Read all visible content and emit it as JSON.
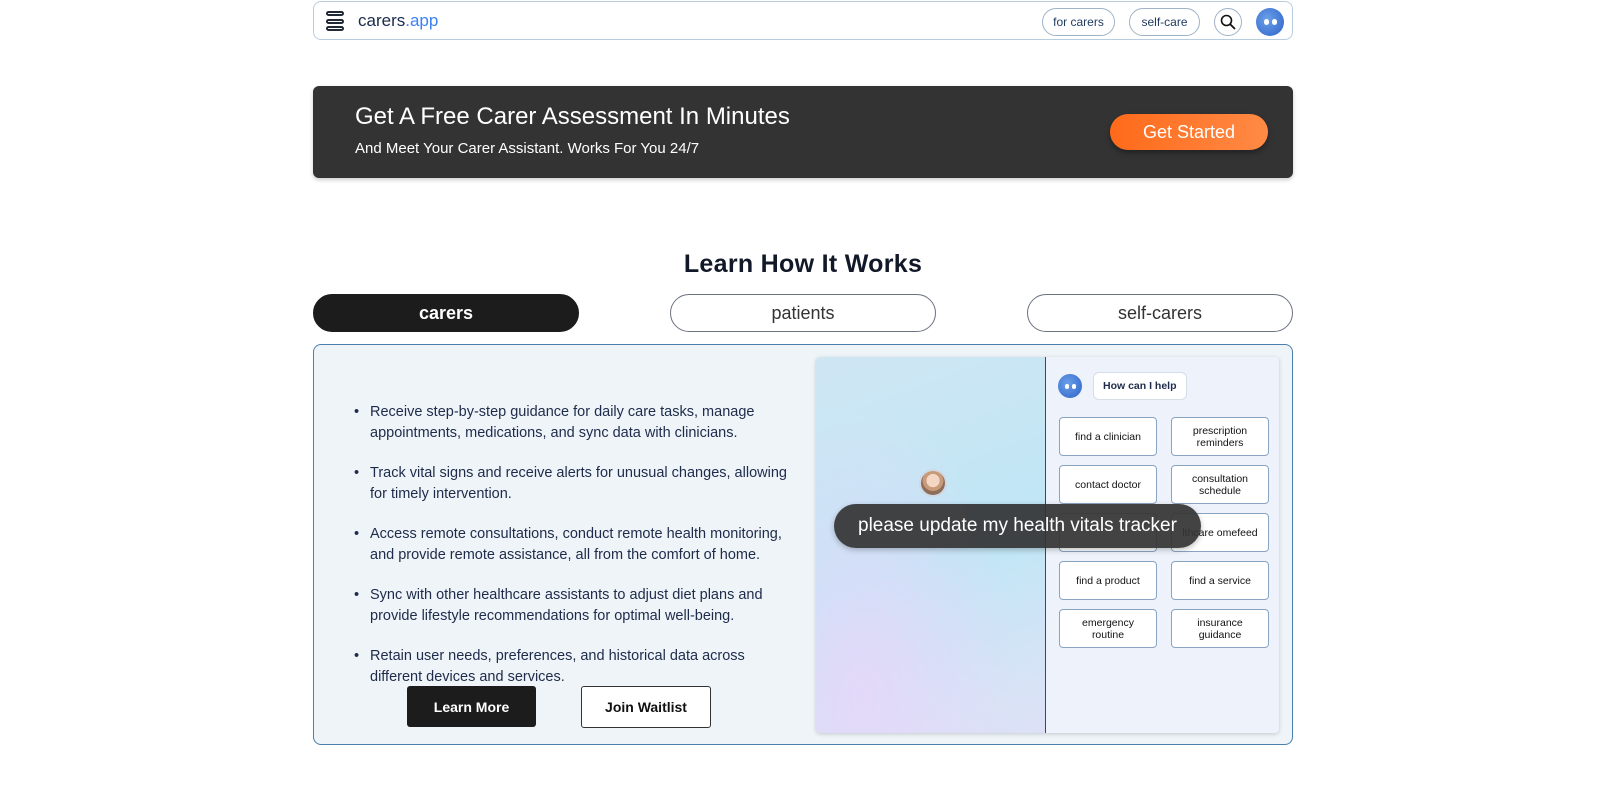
{
  "nav": {
    "logo_main": "carers",
    "logo_accent": ".app",
    "pill_carers": "for carers",
    "pill_selfcare": "self-care"
  },
  "banner": {
    "title": "Get A Free Carer Assessment In Minutes",
    "subtitle": "And Meet Your Carer Assistant. Works For You 24/7",
    "cta": "Get Started"
  },
  "section": {
    "title": "Learn How It Works"
  },
  "tabs": [
    {
      "label": "carers",
      "active": true
    },
    {
      "label": "patients",
      "active": false
    },
    {
      "label": "self-carers",
      "active": false
    }
  ],
  "features": [
    "Receive step-by-step guidance for daily care tasks, manage appointments, medications, and sync data with clinicians.",
    "Track vital signs and receive alerts for unusual changes, allowing for timely intervention.",
    "Access remote consultations, conduct remote health monitoring, and provide remote assistance, all from the comfort of home.",
    "Sync with other healthcare assistants to adjust diet plans and provide lifestyle recommendations for optimal well-being.",
    "Retain user needs, preferences, and historical data across different devices and services."
  ],
  "buttons": {
    "learn_more": "Learn More",
    "join_waitlist": "Join Waitlist"
  },
  "demo": {
    "help_text": "How can I help",
    "prompt": "please update my health vitals tracker",
    "chips": [
      "find a clinician",
      "prescription reminders",
      "contact doctor",
      "consultation schedule",
      "",
      "lthcare omefeed",
      "find a product",
      "find a service",
      "emergency routine",
      "insurance guidance"
    ]
  },
  "colors": {
    "banner_bg": "#333333",
    "cta_orange": "#ff6a1a",
    "accent_blue": "#3b82f6",
    "panel_bg": "#eef4f8"
  }
}
